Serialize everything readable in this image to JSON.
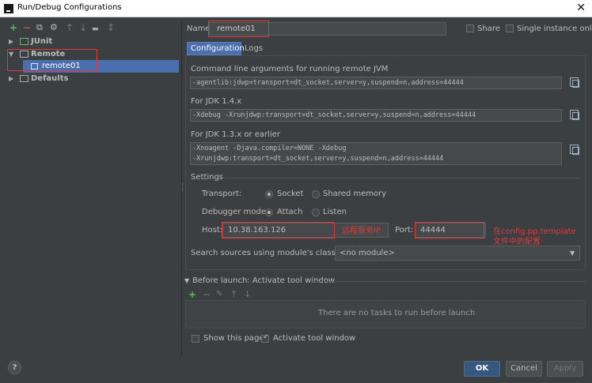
{
  "window": {
    "title": "Run/Debug Configurations"
  },
  "toolbar": {
    "add": "+",
    "remove": "−",
    "copy": "⧉",
    "settings": "⚙",
    "up": "↑",
    "down": "↓",
    "folder": "▬",
    "sort": "↕"
  },
  "tree": {
    "items": [
      {
        "label": "JUnit"
      },
      {
        "label": "Remote"
      },
      {
        "label": "remote01"
      },
      {
        "label": "Defaults"
      }
    ]
  },
  "header": {
    "name_label": "Name:",
    "name_value": "remote01",
    "share_label": "Share",
    "single_instance_label": "Single instance only"
  },
  "tabs": [
    {
      "label": "Configuration"
    },
    {
      "label": "Logs"
    }
  ],
  "config": {
    "cmd_title": "Command line arguments for running remote JVM",
    "cmd_value": "-agentlib:jdwp=transport=dt_socket,server=y,suspend=n,address=44444",
    "jdk14_title": "For JDK 1.4.x",
    "jdk14_value": "-Xdebug -Xrunjdwp:transport=dt_socket,server=y,suspend=n,address=44444",
    "jdk13_title": "For JDK 1.3.x or earlier",
    "jdk13_line1": "-Xnoagent -Djava.compiler=NONE -Xdebug",
    "jdk13_line2": "-Xrunjdwp:transport=dt_socket,server=y,suspend=n,address=44444",
    "settings_title": "Settings",
    "transport_label": "Transport:",
    "transport_socket": "Socket",
    "transport_shared": "Shared memory",
    "mode_label": "Debugger mode:",
    "mode_attach": "Attach",
    "mode_listen": "Listen",
    "host_label": "Host:",
    "host_value": "10.38.163.126",
    "port_label": "Port:",
    "port_value": "44444",
    "sources_label": "Search sources using module's classpath:",
    "sources_value": "<no module>"
  },
  "annotations": {
    "host_note": "远程服务IP",
    "port_note_1": "在config.pp.template",
    "port_note_2": "文件中的配置"
  },
  "before_launch": {
    "title": "Before launch: Activate tool window",
    "add": "+",
    "remove": "−",
    "edit": "✎",
    "up": "↑",
    "down": "↓",
    "empty_text": "There are no tasks to run before launch",
    "show_page_label": "Show this page",
    "activate_label": "Activate tool window"
  },
  "buttons": {
    "help": "?",
    "ok": "OK",
    "cancel": "Cancel",
    "apply": "Apply"
  },
  "colors": {
    "accent": "#365880",
    "highlight": "#e0393e",
    "selection": "#4b6eaf"
  }
}
